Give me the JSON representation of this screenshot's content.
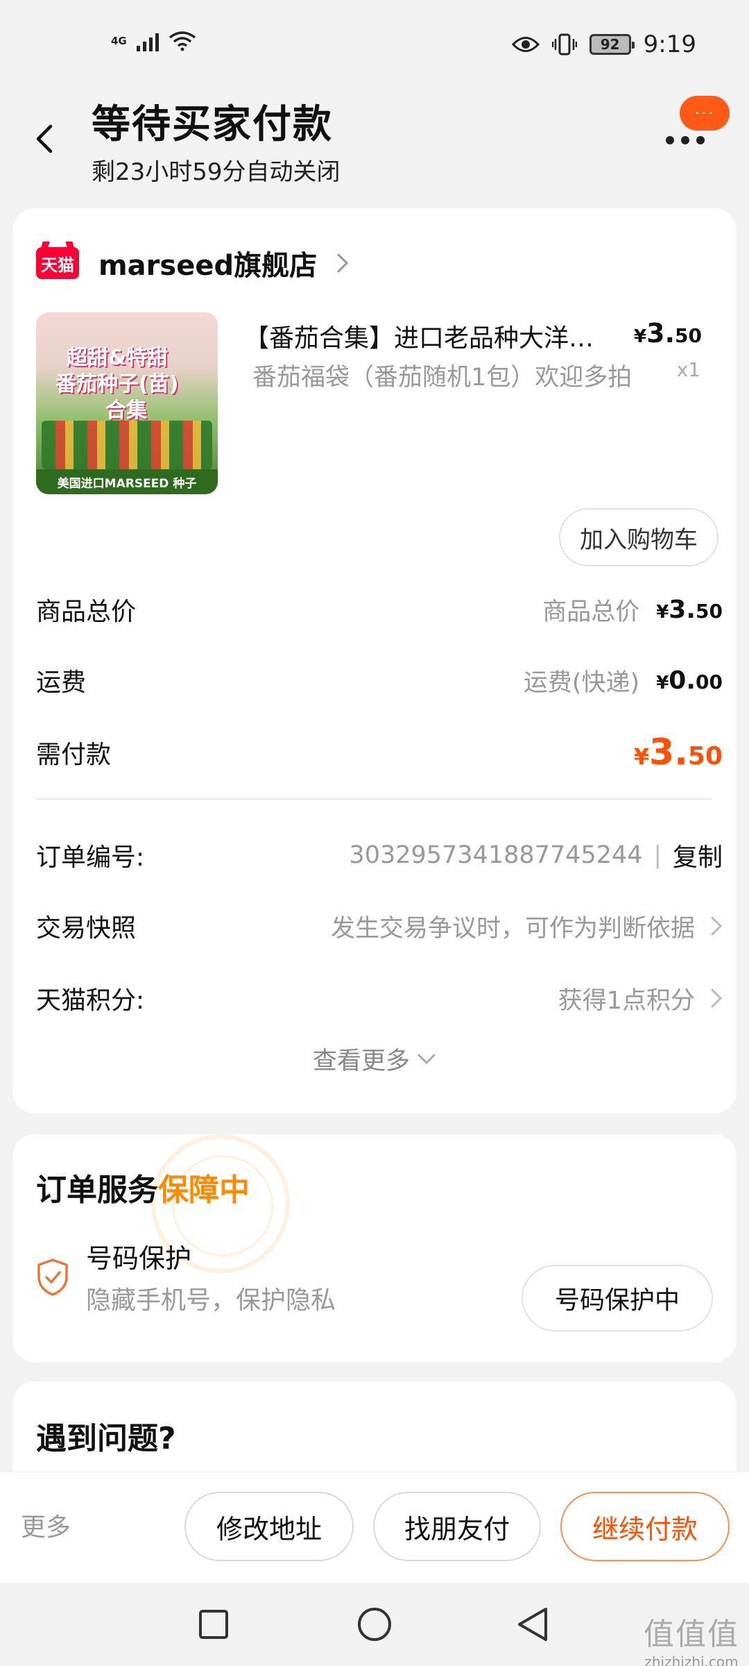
{
  "status_bar": {
    "network": "4G",
    "battery": "92",
    "time": "9:19"
  },
  "header": {
    "title": "等待买家付款",
    "subtitle": "剩23小时59分自动关闭",
    "bubble_text": "···"
  },
  "shop": {
    "logo_text": "天猫",
    "name": "marseed旗舰店"
  },
  "product": {
    "image_text": {
      "line1": "超甜&特甜",
      "line2": "番茄种子(苗)",
      "line3": "合集",
      "strip": "美国进口MARSEED 种子"
    },
    "title": "【番茄合集】进口老品种大洋…",
    "desc": "番茄福袋（番茄随机1包）欢迎多拍",
    "price_yen": "¥",
    "price_int": "3.",
    "price_dec": "50",
    "qty": "x1",
    "add_cart": "加入购物车"
  },
  "summary": {
    "total_label": "商品总价",
    "total_note": "商品总价",
    "total_int": "3.",
    "total_dec": "50",
    "shipping_label": "运费",
    "shipping_note": "运费(快递)",
    "shipping_int": "0.",
    "shipping_dec": "00",
    "due_label": "需付款",
    "due_int": "3.",
    "due_dec": "50",
    "yen": "¥"
  },
  "details": {
    "order_no_label": "订单编号:",
    "order_no": "3032957341887745244",
    "sep": "|",
    "copy": "复制",
    "snapshot_label": "交易快照",
    "snapshot_note": "发生交易争议时，可作为判断依据",
    "points_label": "天猫积分:",
    "points_note": "获得1点积分",
    "view_more": "查看更多"
  },
  "service": {
    "title_prefix": "订单服务",
    "title_status": "保障中",
    "item_name": "号码保护",
    "item_desc": "隐藏手机号，保护隐私",
    "item_btn": "号码保护中"
  },
  "issue": {
    "title": "遇到问题?"
  },
  "actions": {
    "more": "更多",
    "modify_address": "修改地址",
    "friend_pay": "找朋友付",
    "continue_pay": "继续付款"
  },
  "watermark_site": {
    "glyphs": "值值值",
    "url": "zhizhizhi.com"
  },
  "colors": {
    "accent": "#ff5000",
    "tmall_red": "#ff0036",
    "service_orange": "#ff8a00"
  }
}
